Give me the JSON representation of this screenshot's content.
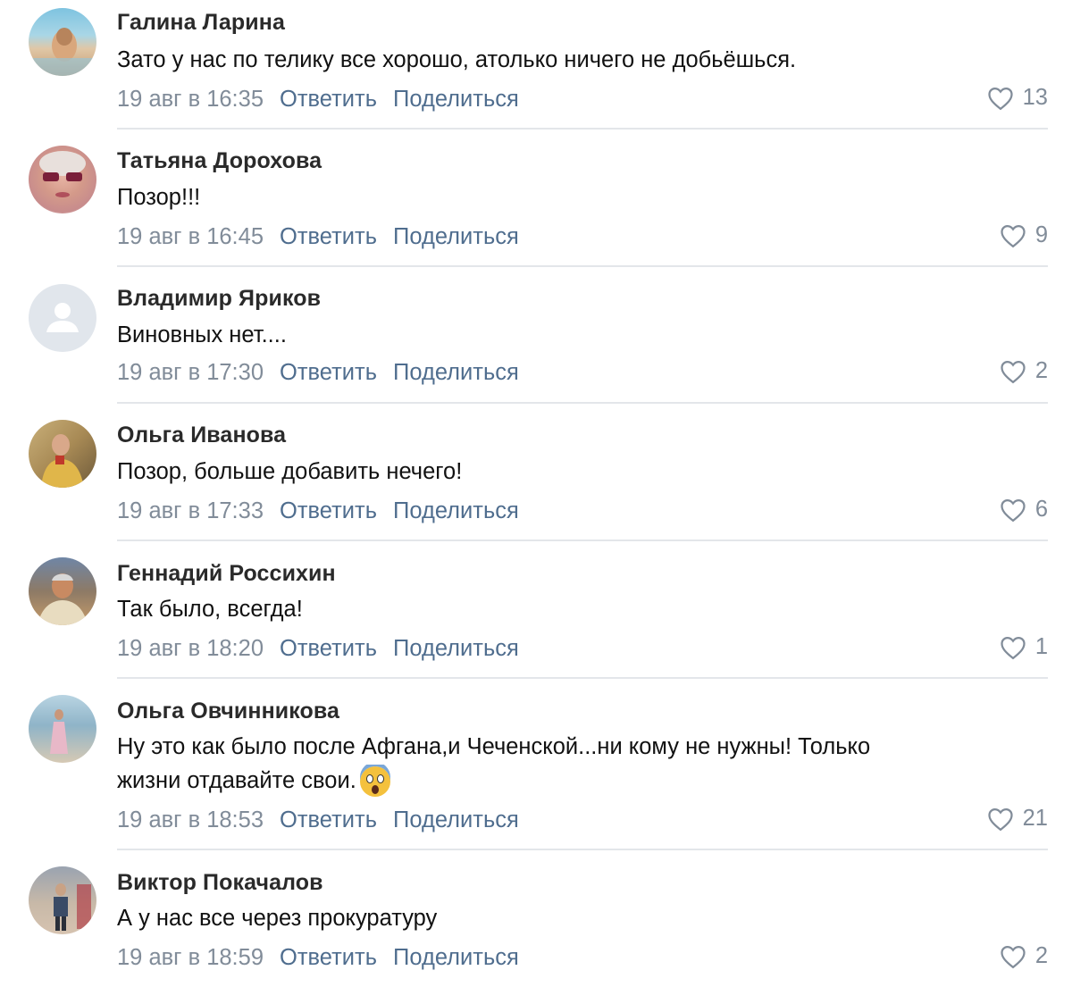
{
  "comments": [
    {
      "name": "Галина Ларина",
      "text": "Зато у нас по телику все хорошо, атолько ничего не добьёшься.",
      "date": "19 авг в 16:35",
      "reply": "Ответить",
      "share": "Поделиться",
      "likes": "13",
      "avatar": "photo-beach"
    },
    {
      "name": "Татьяна Дорохова",
      "text": "Позор!!!",
      "date": "19 авг в 16:45",
      "reply": "Ответить",
      "share": "Поделиться",
      "likes": "9",
      "avatar": "photo-woman-sunglasses"
    },
    {
      "name": "Владимир Яриков",
      "text": "Виновных нет....",
      "date": "19 авг в 17:30",
      "reply": "Ответить",
      "share": "Поделиться",
      "likes": "2",
      "avatar": "default-user-icon"
    },
    {
      "name": "Ольга Иванова",
      "text": "Позор, больше добавить нечего!",
      "date": "19 авг в 17:33",
      "reply": "Ответить",
      "share": "Поделиться",
      "likes": "6",
      "avatar": "photo-woman-yellow"
    },
    {
      "name": "Геннадий Россихин",
      "text": "Так было, всегда!",
      "date": "19 авг в 18:20",
      "reply": "Ответить",
      "share": "Поделиться",
      "likes": "1",
      "avatar": "photo-man-outdoor"
    },
    {
      "name": "Ольга Овчинникова",
      "text": "Ну это как было после Афгана,и Чеченской...ни кому не нужны! Только",
      "text2": "жизни отдавайте свои.",
      "emoji": "scream-emoji",
      "date": "19 авг в 18:53",
      "reply": "Ответить",
      "share": "Поделиться",
      "likes": "21",
      "avatar": "photo-woman-sea"
    },
    {
      "name": "Виктор Покачалов",
      "text": "А у нас все через прокуратуру",
      "date": "19 авг в 18:59",
      "reply": "Ответить",
      "share": "Поделиться",
      "likes": "2",
      "avatar": "photo-man-standing"
    }
  ],
  "colors": {
    "meta": "#818c99",
    "action": "#4f6d8e",
    "separator": "#e3e6ea"
  }
}
